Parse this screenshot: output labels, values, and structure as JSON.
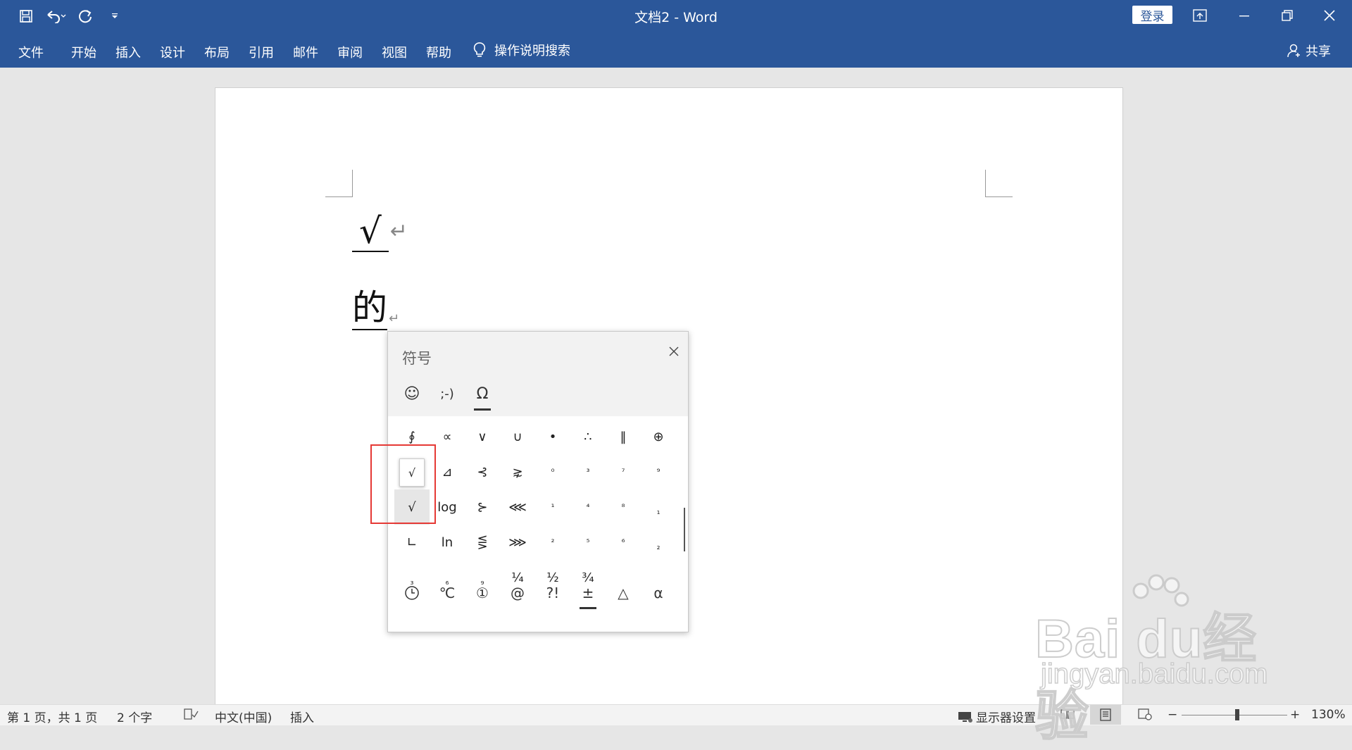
{
  "app": {
    "title": "文档2  -  Word",
    "login_label": "登录"
  },
  "ribbon": {
    "tabs": [
      "文件",
      "开始",
      "插入",
      "设计",
      "布局",
      "引用",
      "邮件",
      "审阅",
      "视图",
      "帮助"
    ],
    "tell_me": "操作说明搜索",
    "share": "共享"
  },
  "document": {
    "line1": "√",
    "line2": "的"
  },
  "symbol_panel": {
    "title": "符号",
    "tabs": [
      {
        "icon": "smiley-icon",
        "label": "☺"
      },
      {
        "icon": "emoticon-icon",
        "label": ";-)"
      },
      {
        "icon": "omega-icon",
        "label": "Ω"
      }
    ],
    "rows": [
      [
        "∮",
        "∝",
        "∨",
        "∪",
        "•",
        "∴",
        "‖",
        "⊕"
      ],
      [
        "",
        "⊿",
        "⊰",
        "⋧",
        "⁰",
        "³",
        "⁷",
        "⁹"
      ],
      [
        "√",
        "log",
        "⊱",
        "⋘",
        "¹",
        "⁴",
        "⁸",
        "₁"
      ],
      [
        "∟",
        "ln",
        "⋚",
        "⋙",
        "²",
        "⁵",
        "⁶",
        "₂"
      ],
      [
        "₃",
        "₆",
        "₉",
        "¼",
        "½",
        "¾",
        "",
        ""
      ]
    ],
    "tooltip": "√",
    "categories": [
      "🕓",
      "℃",
      "①",
      "@",
      "?!",
      "±",
      "△",
      "α"
    ]
  },
  "status": {
    "page": "第 1 页，共 1 页",
    "words": "2 个字",
    "language": "中文(中国)",
    "mode": "插入",
    "display": "显示器设置",
    "zoom": "130%",
    "minus": "−",
    "plus": "+"
  },
  "watermark": {
    "brand": "Bai du经验",
    "url": "jingyan.baidu.com"
  }
}
